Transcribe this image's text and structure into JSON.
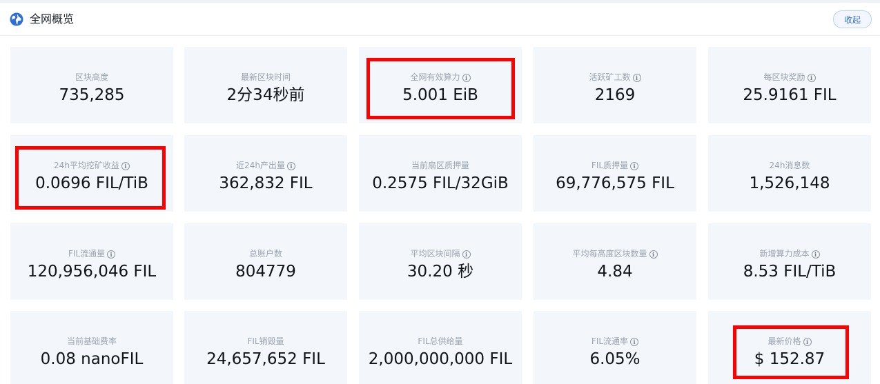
{
  "header": {
    "title": "全网概览",
    "collapse_label": "收起"
  },
  "icons": {
    "globe": "globe-icon",
    "info": "info-icon"
  },
  "colors": {
    "card_bg": "#f3f6fa",
    "accent": "#3a73c8",
    "highlight": "#ff0000"
  },
  "stats": [
    {
      "label": "区块高度",
      "value": "735,285",
      "info": false
    },
    {
      "label": "最新区块时间",
      "value": "2分34秒前",
      "info": false
    },
    {
      "label": "全网有效算力",
      "value": "5.001 EiB",
      "info": true
    },
    {
      "label": "活跃矿工数",
      "value": "2169",
      "info": true
    },
    {
      "label": "每区块奖励",
      "value": "25.9161 FIL",
      "info": true
    },
    {
      "label": "24h平均挖矿收益",
      "value": "0.0696 FIL/TiB",
      "info": true
    },
    {
      "label": "近24h产出量",
      "value": "362,832 FIL",
      "info": true
    },
    {
      "label": "当前扇区质押量",
      "value": "0.2575 FIL/32GiB",
      "info": false
    },
    {
      "label": "FIL质押量",
      "value": "69,776,575 FIL",
      "info": true
    },
    {
      "label": "24h消息数",
      "value": "1,526,148",
      "info": false
    },
    {
      "label": "FIL流通量",
      "value": "120,956,046 FIL",
      "info": true
    },
    {
      "label": "总账户数",
      "value": "804779",
      "info": false
    },
    {
      "label": "平均区块间隔",
      "value": "30.20 秒",
      "info": true
    },
    {
      "label": "平均每高度区块数量",
      "value": "4.84",
      "info": true
    },
    {
      "label": "新增算力成本",
      "value": "8.53 FIL/TiB",
      "info": true
    },
    {
      "label": "当前基础费率",
      "value": "0.08 nanoFIL",
      "info": false
    },
    {
      "label": "FIL销毁量",
      "value": "24,657,652 FIL",
      "info": false
    },
    {
      "label": "FIL总供给量",
      "value": "2,000,000,000 FIL",
      "info": false
    },
    {
      "label": "FIL流通率",
      "value": "6.05%",
      "info": true
    },
    {
      "label": "最新价格",
      "value": "$ 152.87",
      "info": true
    }
  ]
}
